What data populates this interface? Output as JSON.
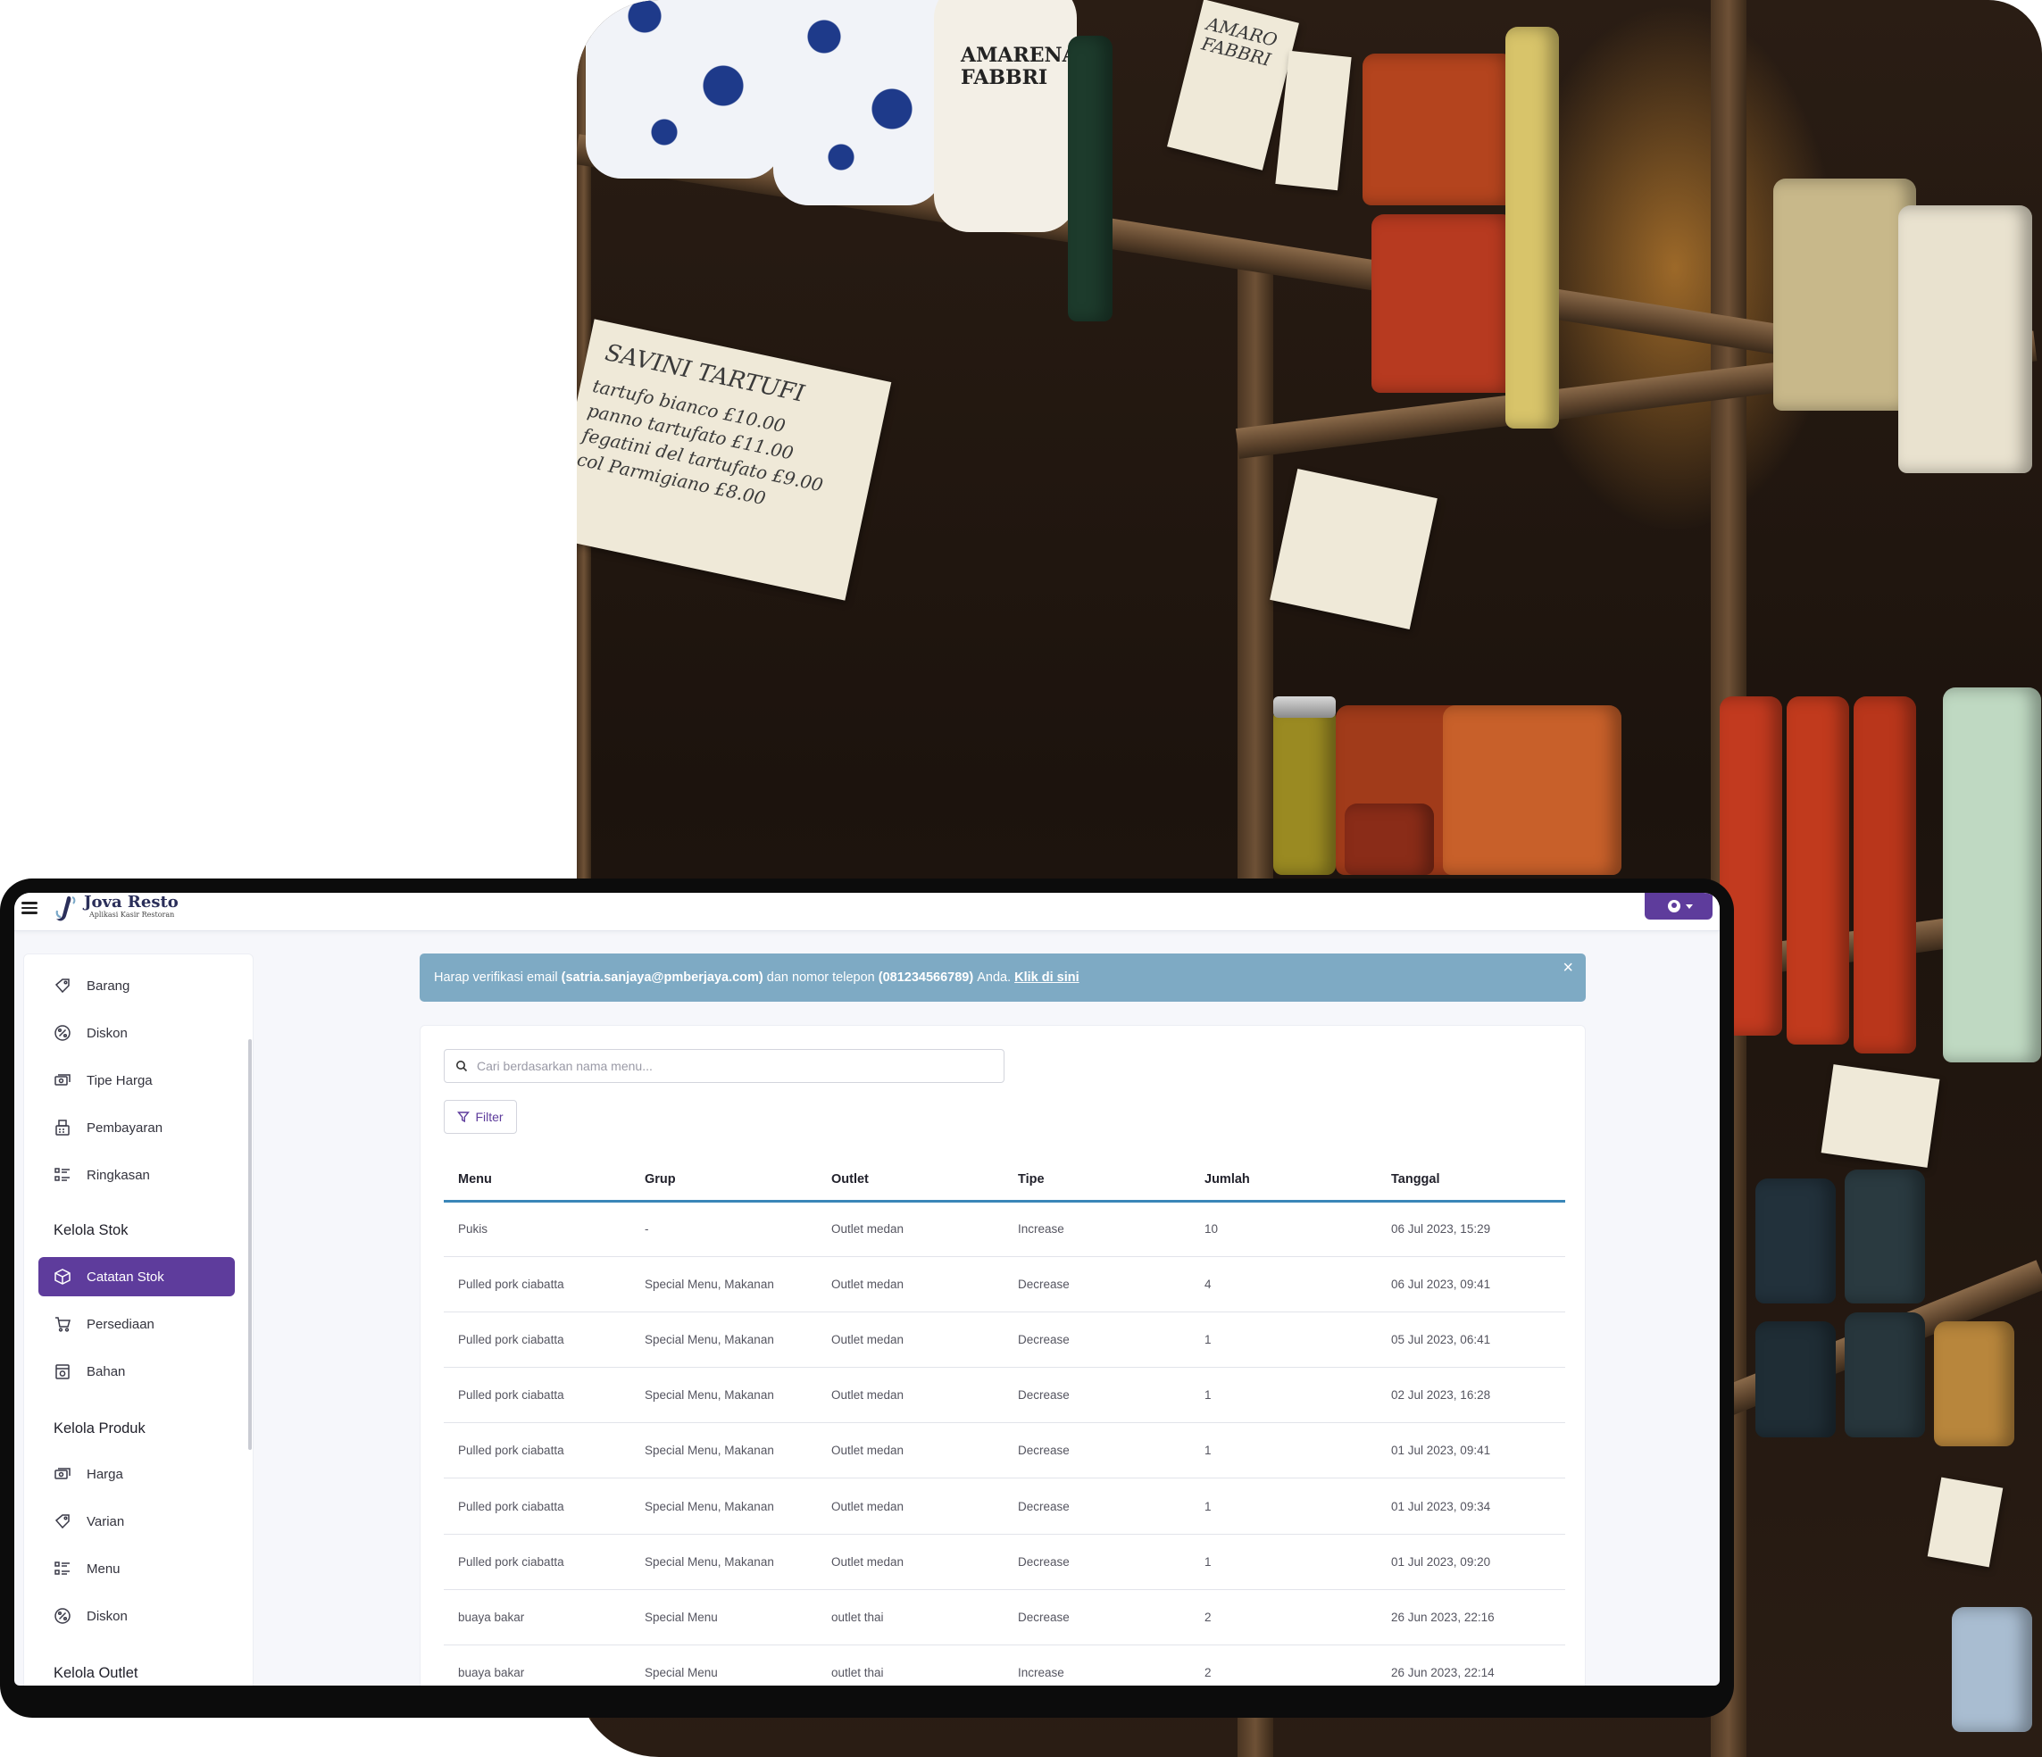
{
  "app": {
    "name": "Jova Resto",
    "tagline": "Aplikasi Kasir Restoran"
  },
  "colors": {
    "primary": "#5e3c9c",
    "alert_bg": "#7eaac4",
    "table_header_rule": "#3a86b8"
  },
  "photo": {
    "tag_tartufi": "SAVINI TARTUFI",
    "tag_tartufi_lines": [
      "tartufo bianco   £10.00",
      "panno tartufato  £11.00",
      "fegatini del tartufato  £9.00",
      "col Parmigiano  £8.00"
    ],
    "tag_amaro": "AMARO FABBRI",
    "vase_label": "AMARENA FABBRI"
  },
  "sidebar": {
    "items_top": [
      {
        "label": "Barang",
        "icon": "tag-icon"
      },
      {
        "label": "Diskon",
        "icon": "discount-icon"
      },
      {
        "label": "Tipe Harga",
        "icon": "cash-icon"
      },
      {
        "label": "Pembayaran",
        "icon": "register-icon"
      },
      {
        "label": "Ringkasan",
        "icon": "list-icon"
      }
    ],
    "section_stok": "Kelola Stok",
    "items_stok": [
      {
        "label": "Catatan Stok",
        "icon": "box-icon",
        "active": true
      },
      {
        "label": "Persediaan",
        "icon": "cart-icon"
      },
      {
        "label": "Bahan",
        "icon": "ingredient-icon"
      }
    ],
    "section_produk": "Kelola Produk",
    "items_produk": [
      {
        "label": "Harga",
        "icon": "cash-icon"
      },
      {
        "label": "Varian",
        "icon": "tag-icon"
      },
      {
        "label": "Menu",
        "icon": "list-icon"
      },
      {
        "label": "Diskon",
        "icon": "discount-icon"
      }
    ],
    "section_outlet": "Kelola Outlet"
  },
  "alert": {
    "prefix": "Harap verifikasi email",
    "email": "(satria.sanjaya@pmberjaya.com)",
    "middle": "dan nomor telepon",
    "phone": "(081234566789)",
    "suffix": "Anda.",
    "link": "Klik di sini",
    "close": "×"
  },
  "search": {
    "placeholder": "Cari berdasarkan nama menu..."
  },
  "filter": {
    "label": "Filter"
  },
  "table": {
    "headers": [
      "Menu",
      "Grup",
      "Outlet",
      "Tipe",
      "Jumlah",
      "Tanggal"
    ],
    "rows": [
      [
        "Pukis",
        "-",
        "Outlet medan",
        "Increase",
        "10",
        "06 Jul 2023, 15:29"
      ],
      [
        "Pulled pork ciabatta",
        "Special Menu, Makanan",
        "Outlet medan",
        "Decrease",
        "4",
        "06 Jul 2023, 09:41"
      ],
      [
        "Pulled pork ciabatta",
        "Special Menu, Makanan",
        "Outlet medan",
        "Decrease",
        "1",
        "05 Jul 2023, 06:41"
      ],
      [
        "Pulled pork ciabatta",
        "Special Menu, Makanan",
        "Outlet medan",
        "Decrease",
        "1",
        "02 Jul 2023, 16:28"
      ],
      [
        "Pulled pork ciabatta",
        "Special Menu, Makanan",
        "Outlet medan",
        "Decrease",
        "1",
        "01 Jul 2023, 09:41"
      ],
      [
        "Pulled pork ciabatta",
        "Special Menu, Makanan",
        "Outlet medan",
        "Decrease",
        "1",
        "01 Jul 2023, 09:34"
      ],
      [
        "Pulled pork ciabatta",
        "Special Menu, Makanan",
        "Outlet medan",
        "Decrease",
        "1",
        "01 Jul 2023, 09:20"
      ],
      [
        "buaya bakar",
        "Special Menu",
        "outlet thai",
        "Decrease",
        "2",
        "26 Jun 2023, 22:16"
      ],
      [
        "buaya bakar",
        "Special Menu",
        "outlet thai",
        "Increase",
        "2",
        "26 Jun 2023, 22:14"
      ]
    ]
  }
}
